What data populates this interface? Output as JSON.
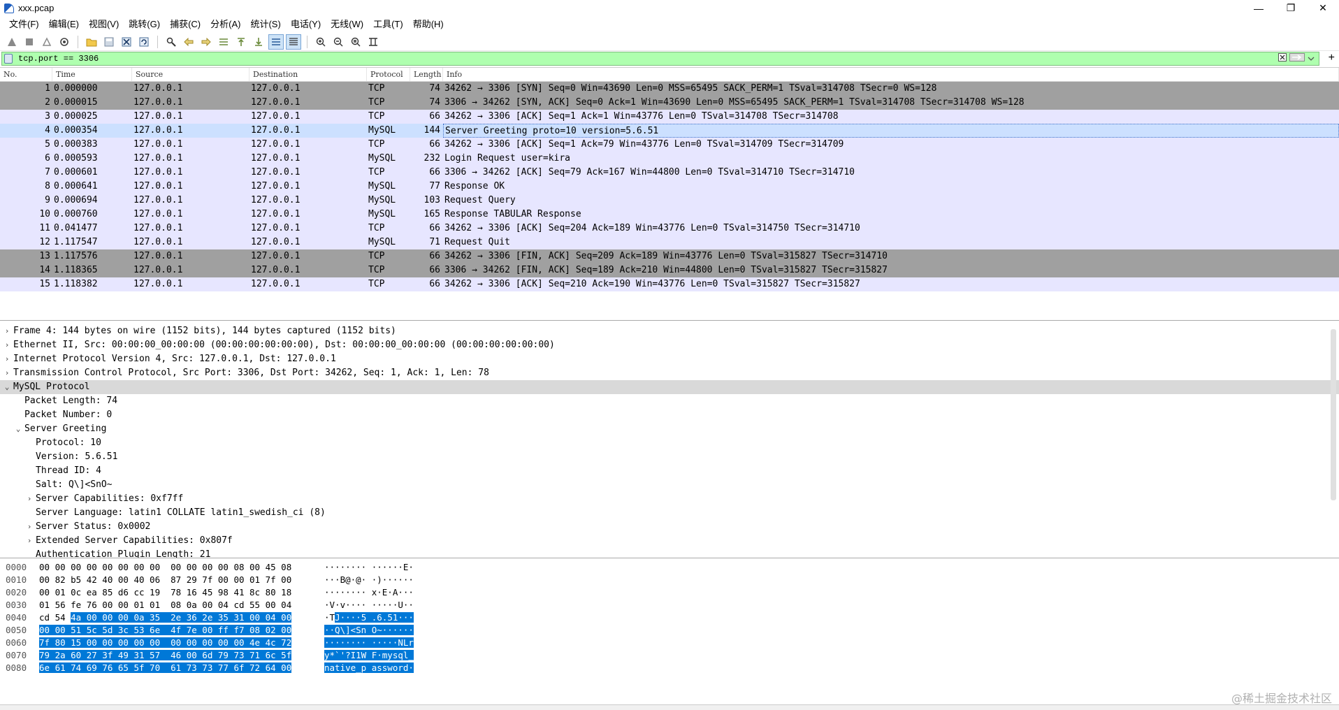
{
  "window": {
    "title": "xxx.pcap",
    "minimize": "—",
    "maximize": "❐",
    "close": "✕"
  },
  "menu": [
    "文件(F)",
    "编辑(E)",
    "视图(V)",
    "跳转(G)",
    "捕获(C)",
    "分析(A)",
    "统计(S)",
    "电话(Y)",
    "无线(W)",
    "工具(T)",
    "帮助(H)"
  ],
  "filter": {
    "value": "tcp.port == 3306"
  },
  "columns": [
    "No.",
    "Time",
    "Source",
    "Destination",
    "Protocol",
    "Length",
    "Info"
  ],
  "packets": [
    {
      "no": "1",
      "time": "0.000000",
      "src": "127.0.0.1",
      "dst": "127.0.0.1",
      "proto": "TCP",
      "len": "74",
      "info": "34262 → 3306 [SYN] Seq=0 Win=43690 Len=0 MSS=65495 SACK_PERM=1 TSval=314708 TSecr=0 WS=128",
      "style": "gray"
    },
    {
      "no": "2",
      "time": "0.000015",
      "src": "127.0.0.1",
      "dst": "127.0.0.1",
      "proto": "TCP",
      "len": "74",
      "info": "3306 → 34262 [SYN, ACK] Seq=0 Ack=1 Win=43690 Len=0 MSS=65495 SACK_PERM=1 TSval=314708 TSecr=314708 WS=128",
      "style": "gray"
    },
    {
      "no": "3",
      "time": "0.000025",
      "src": "127.0.0.1",
      "dst": "127.0.0.1",
      "proto": "TCP",
      "len": "66",
      "info": "34262 → 3306 [ACK] Seq=1 Ack=1 Win=43776 Len=0 TSval=314708 TSecr=314708",
      "style": "lav"
    },
    {
      "no": "4",
      "time": "0.000354",
      "src": "127.0.0.1",
      "dst": "127.0.0.1",
      "proto": "MySQL",
      "len": "144",
      "info": "Server Greeting  proto=10 version=5.6.51",
      "style": "sel"
    },
    {
      "no": "5",
      "time": "0.000383",
      "src": "127.0.0.1",
      "dst": "127.0.0.1",
      "proto": "TCP",
      "len": "66",
      "info": "34262 → 3306 [ACK] Seq=1 Ack=79 Win=43776 Len=0 TSval=314709 TSecr=314709",
      "style": "lav"
    },
    {
      "no": "6",
      "time": "0.000593",
      "src": "127.0.0.1",
      "dst": "127.0.0.1",
      "proto": "MySQL",
      "len": "232",
      "info": "Login Request user=kira",
      "style": "lav"
    },
    {
      "no": "7",
      "time": "0.000601",
      "src": "127.0.0.1",
      "dst": "127.0.0.1",
      "proto": "TCP",
      "len": "66",
      "info": "3306 → 34262 [ACK] Seq=79 Ack=167 Win=44800 Len=0 TSval=314710 TSecr=314710",
      "style": "lav"
    },
    {
      "no": "8",
      "time": "0.000641",
      "src": "127.0.0.1",
      "dst": "127.0.0.1",
      "proto": "MySQL",
      "len": "77",
      "info": "Response  OK",
      "style": "lav"
    },
    {
      "no": "9",
      "time": "0.000694",
      "src": "127.0.0.1",
      "dst": "127.0.0.1",
      "proto": "MySQL",
      "len": "103",
      "info": "Request Query",
      "style": "lav"
    },
    {
      "no": "10",
      "time": "0.000760",
      "src": "127.0.0.1",
      "dst": "127.0.0.1",
      "proto": "MySQL",
      "len": "165",
      "info": "Response TABULAR Response",
      "style": "lav"
    },
    {
      "no": "11",
      "time": "0.041477",
      "src": "127.0.0.1",
      "dst": "127.0.0.1",
      "proto": "TCP",
      "len": "66",
      "info": "34262 → 3306 [ACK] Seq=204 Ack=189 Win=43776 Len=0 TSval=314750 TSecr=314710",
      "style": "lav"
    },
    {
      "no": "12",
      "time": "1.117547",
      "src": "127.0.0.1",
      "dst": "127.0.0.1",
      "proto": "MySQL",
      "len": "71",
      "info": "Request Quit",
      "style": "lav"
    },
    {
      "no": "13",
      "time": "1.117576",
      "src": "127.0.0.1",
      "dst": "127.0.0.1",
      "proto": "TCP",
      "len": "66",
      "info": "34262 → 3306 [FIN, ACK] Seq=209 Ack=189 Win=43776 Len=0 TSval=315827 TSecr=314710",
      "style": "gray"
    },
    {
      "no": "14",
      "time": "1.118365",
      "src": "127.0.0.1",
      "dst": "127.0.0.1",
      "proto": "TCP",
      "len": "66",
      "info": "3306 → 34262 [FIN, ACK] Seq=189 Ack=210 Win=44800 Len=0 TSval=315827 TSecr=315827",
      "style": "gray"
    },
    {
      "no": "15",
      "time": "1.118382",
      "src": "127.0.0.1",
      "dst": "127.0.0.1",
      "proto": "TCP",
      "len": "66",
      "info": "34262 → 3306 [ACK] Seq=210 Ack=190 Win=43776 Len=0 TSval=315827 TSecr=315827",
      "style": "lav"
    }
  ],
  "details": [
    {
      "depth": 0,
      "arrow": "right",
      "text": "Frame 4: 144 bytes on wire (1152 bits), 144 bytes captured (1152 bits)"
    },
    {
      "depth": 0,
      "arrow": "right",
      "text": "Ethernet II, Src: 00:00:00_00:00:00 (00:00:00:00:00:00), Dst: 00:00:00_00:00:00 (00:00:00:00:00:00)"
    },
    {
      "depth": 0,
      "arrow": "right",
      "text": "Internet Protocol Version 4, Src: 127.0.0.1, Dst: 127.0.0.1"
    },
    {
      "depth": 0,
      "arrow": "right",
      "text": "Transmission Control Protocol, Src Port: 3306, Dst Port: 34262, Seq: 1, Ack: 1, Len: 78"
    },
    {
      "depth": 0,
      "arrow": "down",
      "text": "MySQL Protocol",
      "selected": true
    },
    {
      "depth": 1,
      "arrow": "none",
      "text": "Packet Length: 74"
    },
    {
      "depth": 1,
      "arrow": "none",
      "text": "Packet Number: 0"
    },
    {
      "depth": 1,
      "arrow": "down",
      "text": "Server Greeting"
    },
    {
      "depth": 2,
      "arrow": "none",
      "text": "Protocol: 10"
    },
    {
      "depth": 2,
      "arrow": "none",
      "text": "Version: 5.6.51"
    },
    {
      "depth": 2,
      "arrow": "none",
      "text": "Thread ID: 4"
    },
    {
      "depth": 2,
      "arrow": "none",
      "text": "Salt: Q\\]<SnO~"
    },
    {
      "depth": 2,
      "arrow": "right",
      "text": "Server Capabilities: 0xf7ff"
    },
    {
      "depth": 2,
      "arrow": "none",
      "text": "Server Language: latin1 COLLATE latin1_swedish_ci (8)"
    },
    {
      "depth": 2,
      "arrow": "right",
      "text": "Server Status: 0x0002"
    },
    {
      "depth": 2,
      "arrow": "right",
      "text": "Extended Server Capabilities: 0x807f"
    },
    {
      "depth": 2,
      "arrow": "none",
      "text": "Authentication Plugin Length: 21"
    }
  ],
  "bytes": [
    {
      "off": "0000",
      "hex_a": "00 00 00 00 00 00 00 00  00 00 00 00 08 00 45 08",
      "hex_b": "",
      "asc_a": "········ ······E·",
      "asc_b": ""
    },
    {
      "off": "0010",
      "hex_a": "00 82 b5 42 40 00 40 06  87 29 7f 00 00 01 7f 00",
      "hex_b": "",
      "asc_a": "···B@·@· ·)······",
      "asc_b": ""
    },
    {
      "off": "0020",
      "hex_a": "00 01 0c ea 85 d6 cc 19  78 16 45 98 41 8c 80 18",
      "hex_b": "",
      "asc_a": "········ x·E·A···",
      "asc_b": ""
    },
    {
      "off": "0030",
      "hex_a": "01 56 fe 76 00 00 01 01  08 0a 00 04 cd 55 00 04",
      "hex_b": "",
      "asc_a": "·V·v···· ·····U··",
      "asc_b": ""
    },
    {
      "off": "0040",
      "hex_a": "cd 54 ",
      "hex_b": "4a 00 00 00 0a 35  2e 36 2e 35 31 00 04 00",
      "asc_a": "·T",
      "asc_b": "J····5 .6.51···"
    },
    {
      "off": "0050",
      "hex_a": "",
      "hex_b": "00 00 51 5c 5d 3c 53 6e  4f 7e 00 ff f7 08 02 00",
      "asc_a": "",
      "asc_b": "··Q\\]<Sn O~······"
    },
    {
      "off": "0060",
      "hex_a": "",
      "hex_b": "7f 80 15 00 00 00 00 00  00 00 00 00 00 4e 4c 72",
      "asc_a": "",
      "asc_b": "········ ·····NLr"
    },
    {
      "off": "0070",
      "hex_a": "",
      "hex_b": "79 2a 60 27 3f 49 31 57  46 00 6d 79 73 71 6c 5f",
      "asc_a": "",
      "asc_b": "y*`'?I1W F·mysql_"
    },
    {
      "off": "0080",
      "hex_a": "",
      "hex_b": "6e 61 74 69 76 65 5f 70  61 73 73 77 6f 72 64 00",
      "asc_a": "",
      "asc_b": "native_p assword·"
    }
  ],
  "watermark": "@稀土掘金技术社区"
}
